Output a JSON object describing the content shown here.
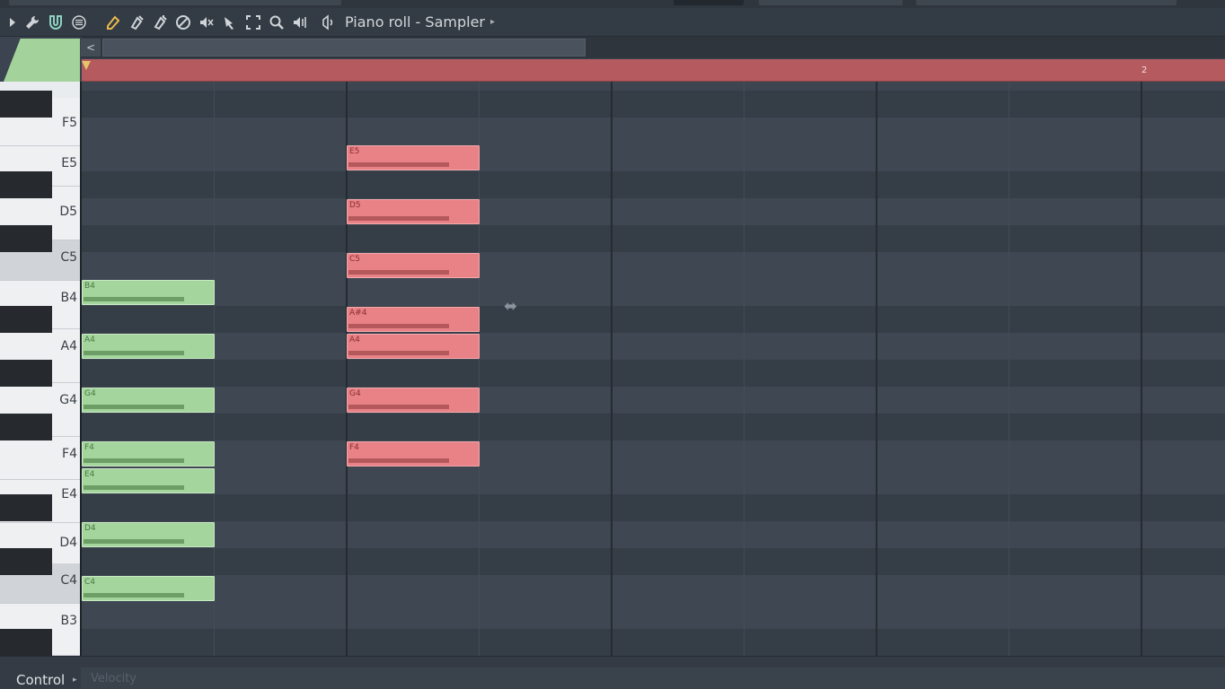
{
  "toolbar": {
    "title": "Piano roll - Sampler",
    "icons": [
      "play-arrow-icon",
      "wrench-icon",
      "magnet-icon",
      "menu-icon",
      "pencil-icon",
      "brush-icon",
      "delete-icon",
      "mute-icon",
      "slice-icon",
      "select-icon",
      "zoom-icon",
      "playback-icon",
      "speaker-icon"
    ]
  },
  "timeline": {
    "bar_marker": "2"
  },
  "keyboard": {
    "labels": [
      "F5",
      "E5",
      "D5",
      "C5",
      "B4",
      "A4",
      "G4",
      "F4",
      "E4",
      "D4",
      "C4",
      "B3"
    ]
  },
  "notes": {
    "green": [
      "B4",
      "A4",
      "G4",
      "F4",
      "E4",
      "D4",
      "C4"
    ],
    "red": [
      "E5",
      "D5",
      "C5",
      "A#4",
      "A4",
      "G4",
      "F4"
    ]
  },
  "bottom": {
    "control_label": "Control",
    "velocity_label": "Velocity"
  },
  "colors": {
    "green_note": "#a4d59d",
    "red_note": "#e88286",
    "timeline": "#b55a5e",
    "background": "#3b4450"
  }
}
